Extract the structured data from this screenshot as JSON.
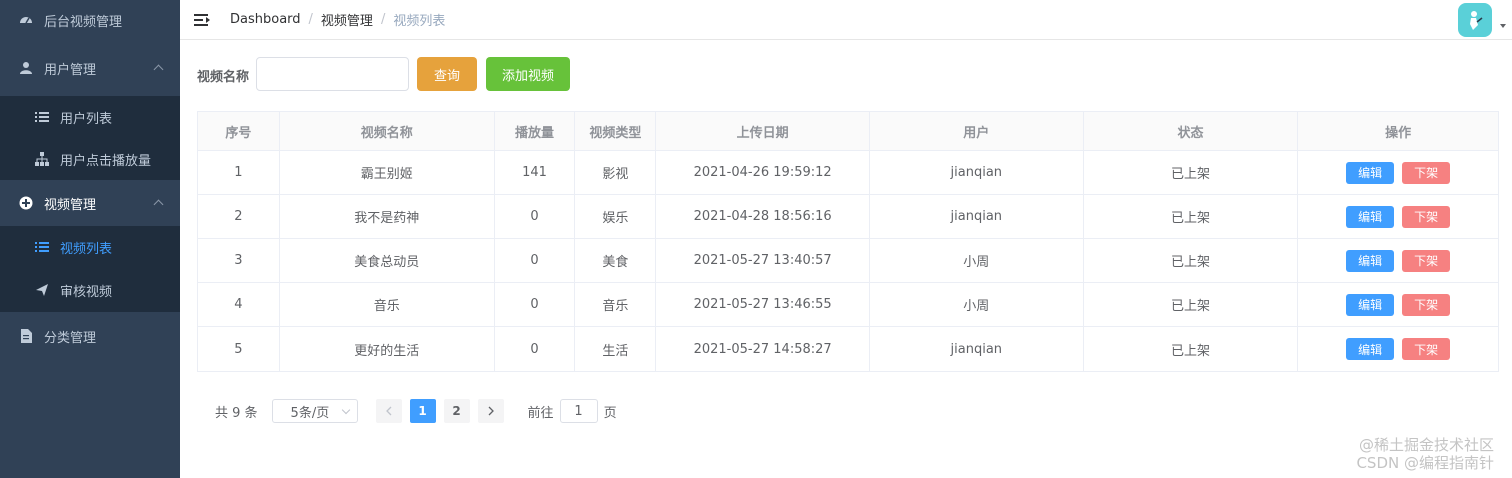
{
  "colors": {
    "sidebar_bg": "#304156",
    "submenu_bg": "#1f2d3d",
    "primary": "#409eff",
    "query_button": "#e6a23c",
    "add_button": "#67c23a",
    "edit_button": "#409eff",
    "offline_button": "#f56c6c",
    "avatar_bg": "#5ad0d8"
  },
  "sidebar": {
    "dashboard": {
      "label": "后台视频管理",
      "icon": "dashboard-icon"
    },
    "user_mgmt": {
      "label": "用户管理",
      "icon": "user-icon",
      "expanded": true,
      "items": [
        {
          "label": "用户列表",
          "icon": "list-icon"
        },
        {
          "label": "用户点击播放量",
          "icon": "sitemap-icon"
        }
      ]
    },
    "video_mgmt": {
      "label": "视频管理",
      "icon": "plus-circle-icon",
      "expanded": true,
      "items": [
        {
          "label": "视频列表",
          "icon": "list-icon",
          "active": true
        },
        {
          "label": "审核视频",
          "icon": "send-icon"
        }
      ]
    },
    "category_mgmt": {
      "label": "分类管理",
      "icon": "document-icon"
    }
  },
  "header": {
    "breadcrumb": [
      "Dashboard",
      "视频管理",
      "视频列表"
    ],
    "separator": "/",
    "avatar_icon": "user-avatar-icon"
  },
  "search": {
    "label": "视频名称",
    "value": "",
    "query_label": "查询",
    "add_label": "添加视频"
  },
  "table": {
    "columns": [
      "序号",
      "视频名称",
      "播放量",
      "视频类型",
      "上传日期",
      "用户",
      "状态",
      "操作"
    ],
    "edit_label": "编辑",
    "offline_label": "下架",
    "rows": [
      [
        "1",
        "霸王别姬",
        "141",
        "影视",
        "2021-04-26 19:59:12",
        "jianqian",
        "已上架"
      ],
      [
        "2",
        "我不是药神",
        "0",
        "娱乐",
        "2021-04-28 18:56:16",
        "jianqian",
        "已上架"
      ],
      [
        "3",
        "美食总动员",
        "0",
        "美食",
        "2021-05-27 13:40:57",
        "小周",
        "已上架"
      ],
      [
        "4",
        "音乐",
        "0",
        "音乐",
        "2021-05-27 13:46:55",
        "小周",
        "已上架"
      ],
      [
        "5",
        "更好的生活",
        "0",
        "生活",
        "2021-05-27 14:58:27",
        "jianqian",
        "已上架"
      ]
    ]
  },
  "pagination": {
    "total": "共 9 条",
    "page_size": "5条/页",
    "pages": [
      "1",
      "2"
    ],
    "current_page": 1,
    "goto_label": "前往",
    "goto_value": "1",
    "goto_suffix": "页"
  },
  "watermark": {
    "line1": "@稀土掘金技术社区",
    "line2": "CSDN @编程指南针"
  }
}
